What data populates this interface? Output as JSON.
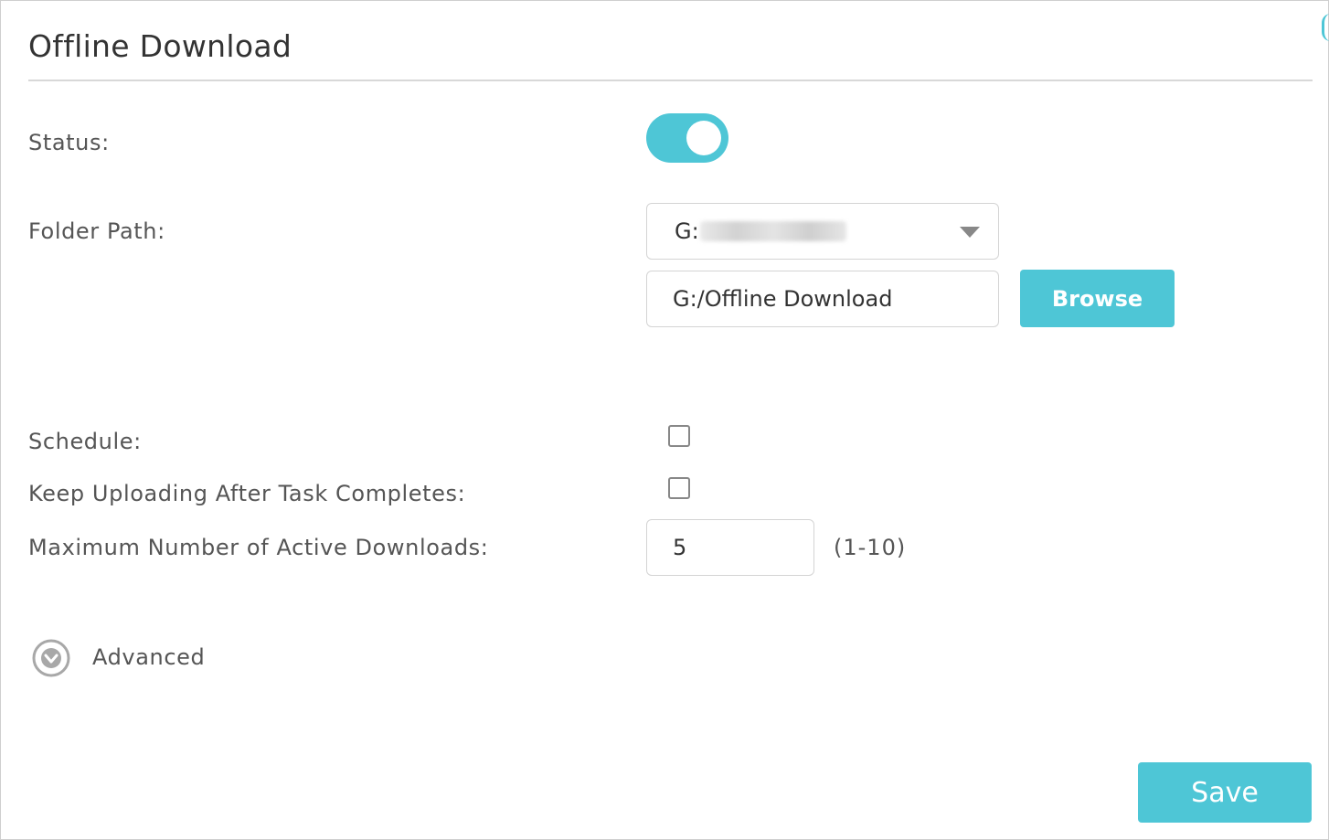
{
  "panel": {
    "title": "Offline Download"
  },
  "form": {
    "status": {
      "label": "Status:",
      "enabled": true
    },
    "folder_path": {
      "label": "Folder Path:",
      "drive_select_value": "G:",
      "path_value": "G:/Offline Download",
      "browse_label": "Browse"
    },
    "schedule": {
      "label": "Schedule:",
      "checked": false
    },
    "keep_uploading": {
      "label": "Keep Uploading After Task Completes:",
      "checked": false
    },
    "max_downloads": {
      "label": "Maximum Number of Active Downloads:",
      "value": "5",
      "range_hint": "(1-10)"
    }
  },
  "advanced": {
    "label": "Advanced",
    "icon": "chevron-down-circle-icon"
  },
  "save_label": "Save",
  "colors": {
    "accent": "#4ec6d6",
    "text": "#333333",
    "label": "#555555",
    "border": "#d4d4d4"
  }
}
